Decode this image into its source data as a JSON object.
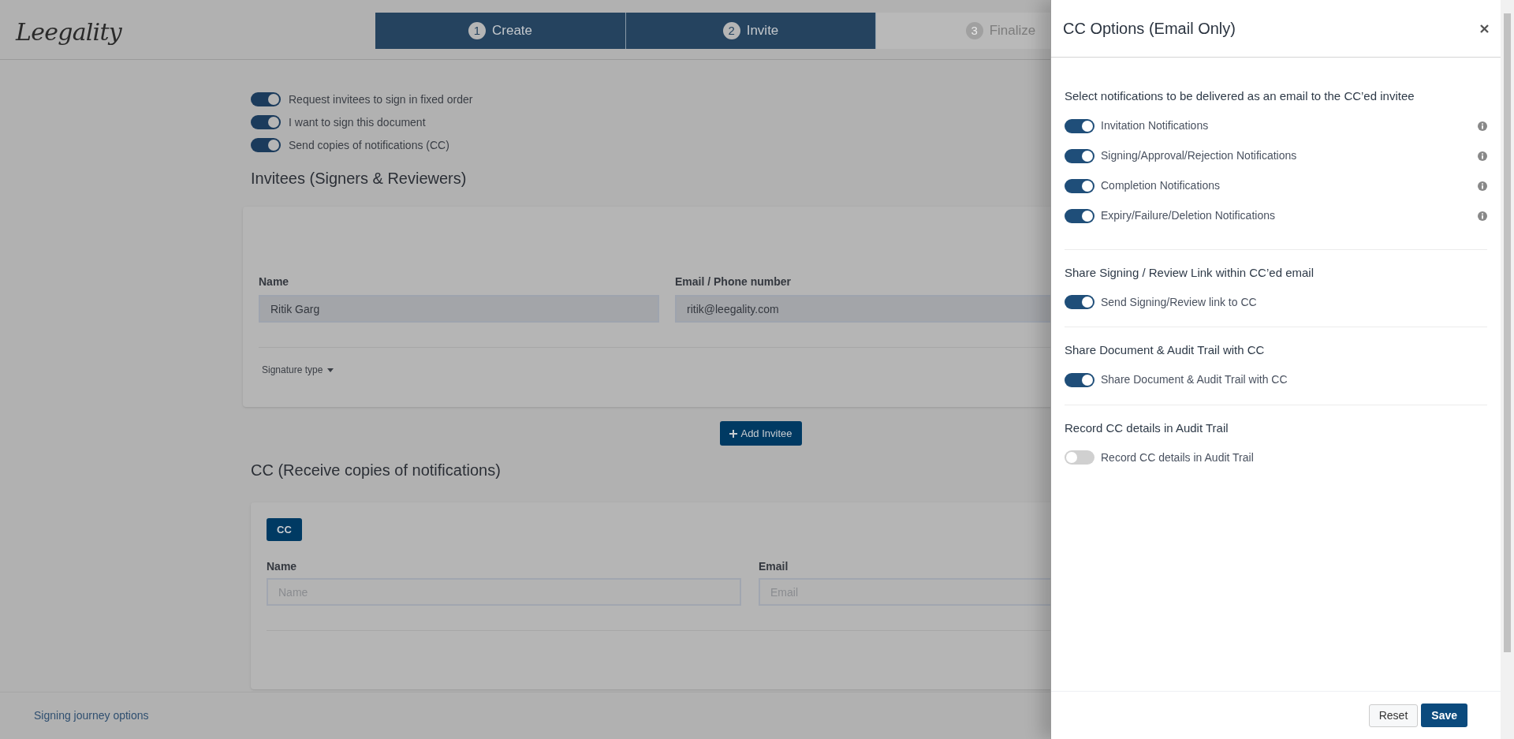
{
  "logo": {
    "text": "Leegality"
  },
  "steps": [
    {
      "number": "1",
      "label": "Create",
      "reached": true
    },
    {
      "number": "2",
      "label": "Invite",
      "reached": true
    },
    {
      "number": "3",
      "label": "Finalize",
      "reached": false
    }
  ],
  "options": [
    {
      "label": "Request invitees to sign in fixed order",
      "on": true
    },
    {
      "label": "I want to sign this document",
      "on": true
    },
    {
      "label": "Send copies of notifications (CC)",
      "on": true
    }
  ],
  "invitees": {
    "heading": "Invitees (Signers & Reviewers)",
    "fields": [
      {
        "label": "Name",
        "value": "Ritik Garg"
      },
      {
        "label": "Email / Phone number",
        "value": "ritik@leegality.com"
      }
    ],
    "signature_type": "Signature type"
  },
  "add_invitee": "Add Invitee",
  "cc": {
    "heading": "CC (Receive copies of notifications)",
    "tab": "CC",
    "fields": [
      {
        "label": "Name",
        "placeholder": "Name"
      },
      {
        "label": "Email",
        "placeholder": "Email"
      }
    ]
  },
  "bottom_bar": {
    "link": "Signing journey options"
  },
  "panel": {
    "title": "CC Options (Email Only)",
    "sections": [
      {
        "heading": "Select notifications to be delivered as an email to the CC’ed invitee",
        "toggles": [
          {
            "label": "Invitation Notifications",
            "on": true,
            "info": true
          },
          {
            "label": "Signing/Approval/Rejection Notifications",
            "on": true,
            "info": true
          },
          {
            "label": "Completion Notifications",
            "on": true,
            "info": true
          },
          {
            "label": "Expiry/Failure/Deletion Notifications",
            "on": true,
            "info": true
          }
        ]
      },
      {
        "heading": "Share Signing / Review Link within CC’ed email",
        "toggles": [
          {
            "label": "Send Signing/Review link to CC",
            "on": true,
            "info": false
          }
        ]
      },
      {
        "heading": "Share Document & Audit Trail with CC",
        "toggles": [
          {
            "label": "Share Document & Audit Trail with CC",
            "on": true,
            "info": false
          }
        ]
      },
      {
        "heading": "Record CC details in Audit Trail",
        "toggles": [
          {
            "label": "Record CC details in Audit Trail",
            "on": false,
            "info": false
          }
        ]
      }
    ],
    "reset": "Reset",
    "save": "Save"
  }
}
